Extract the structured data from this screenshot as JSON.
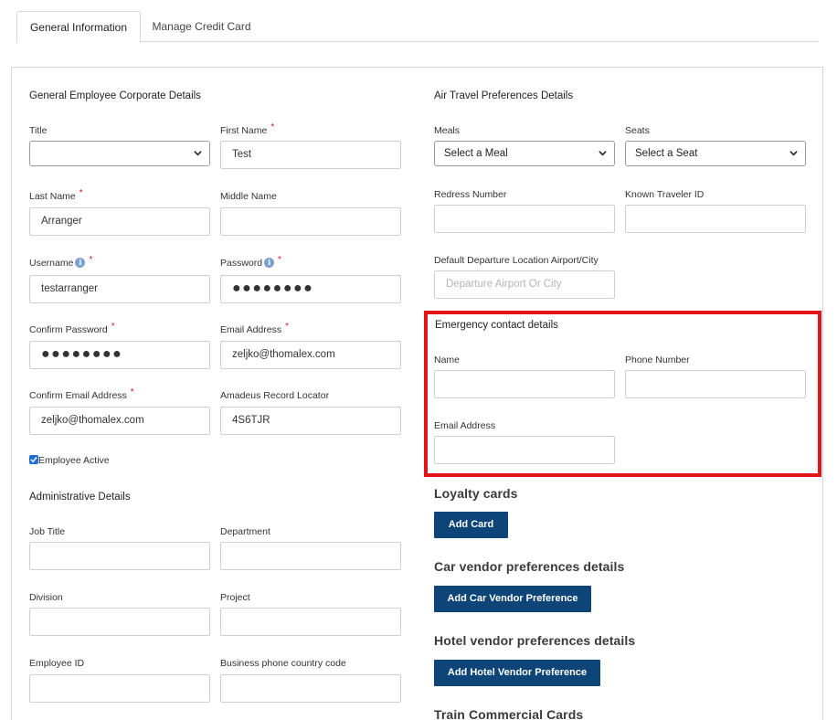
{
  "tabs": {
    "general": "General Information",
    "credit": "Manage Credit Card"
  },
  "left": {
    "corporate_title": "General Employee Corporate Details",
    "title_label": "Title",
    "title_value": "",
    "first_name_label": "First Name",
    "first_name_value": "Test",
    "last_name_label": "Last Name",
    "last_name_value": "Arranger",
    "middle_name_label": "Middle Name",
    "middle_name_value": "",
    "username_label": "Username",
    "username_value": "testarranger",
    "password_label": "Password",
    "password_value": "●●●●●●●●",
    "confirm_password_label": "Confirm Password",
    "confirm_password_value": "●●●●●●●●",
    "email_label": "Email Address",
    "email_value": "zeljko@thomalex.com",
    "confirm_email_label": "Confirm Email Address",
    "confirm_email_value": "zeljko@thomalex.com",
    "record_locator_label": "Amadeus Record Locator",
    "record_locator_value": "4S6TJR",
    "employee_active_label": "Employee Active",
    "admin_title": "Administrative Details",
    "job_title_label": "Job Title",
    "department_label": "Department",
    "division_label": "Division",
    "project_label": "Project",
    "employee_id_label": "Employee ID",
    "business_phone_label": "Business phone country code"
  },
  "right": {
    "air_title": "Air Travel Preferences Details",
    "meals_label": "Meals",
    "meals_value": "Select a Meal",
    "seats_label": "Seats",
    "seats_value": "Select a Seat",
    "redress_label": "Redress Number",
    "known_traveler_label": "Known Traveler ID",
    "departure_label": "Default Departure Location Airport/City",
    "departure_placeholder": "Departure Airport Or City",
    "emergency_title": "Emergency contact details",
    "em_name_label": "Name",
    "em_phone_label": "Phone Number",
    "em_email_label": "Email Address",
    "loyalty_title": "Loyalty cards",
    "add_card": "Add Card",
    "car_title": "Car vendor preferences details",
    "add_car": "Add Car Vendor Preference",
    "hotel_title": "Hotel vendor preferences details",
    "add_hotel": "Add Hotel Vendor Preference",
    "train_title": "Train Commercial Cards"
  },
  "colors": {
    "button_bg": "#0d4578",
    "highlight": "#e4141b",
    "required": "#d32020"
  }
}
